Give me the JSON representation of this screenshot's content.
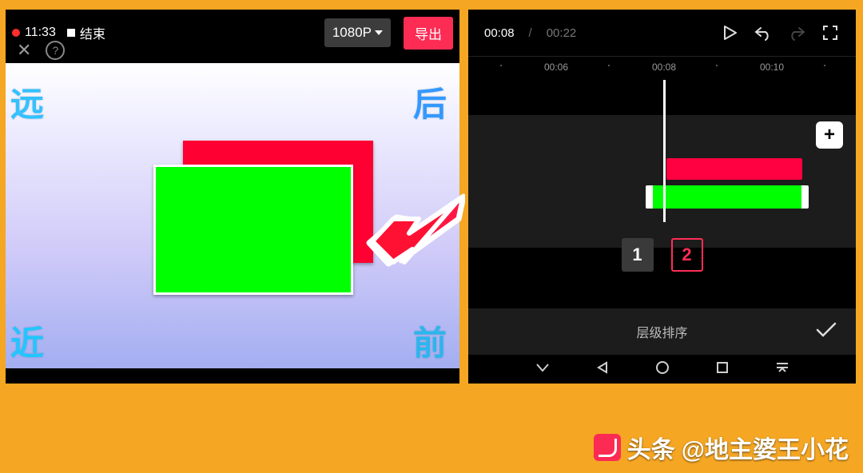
{
  "left": {
    "recording_time": "11:33",
    "end_label": "结束",
    "resolution": "1080P",
    "export_label": "导出",
    "corners": {
      "tl": "远",
      "tr": "后",
      "bl": "近",
      "br": "前"
    }
  },
  "right": {
    "time_current": "00:08",
    "time_total": "00:22",
    "ruler": {
      "t0": "00:06",
      "t1": "00:08",
      "t2": "00:10"
    },
    "layers": {
      "one": "1",
      "two": "2"
    },
    "sort_label": "层级排序"
  },
  "caption": {
    "brand": "头条",
    "handle": "@地主婆王小花"
  },
  "colors": {
    "accent_red": "#fd2c55",
    "clip_red": "#ff0033",
    "clip_green": "#00ff00",
    "frame": "#f5a623"
  }
}
